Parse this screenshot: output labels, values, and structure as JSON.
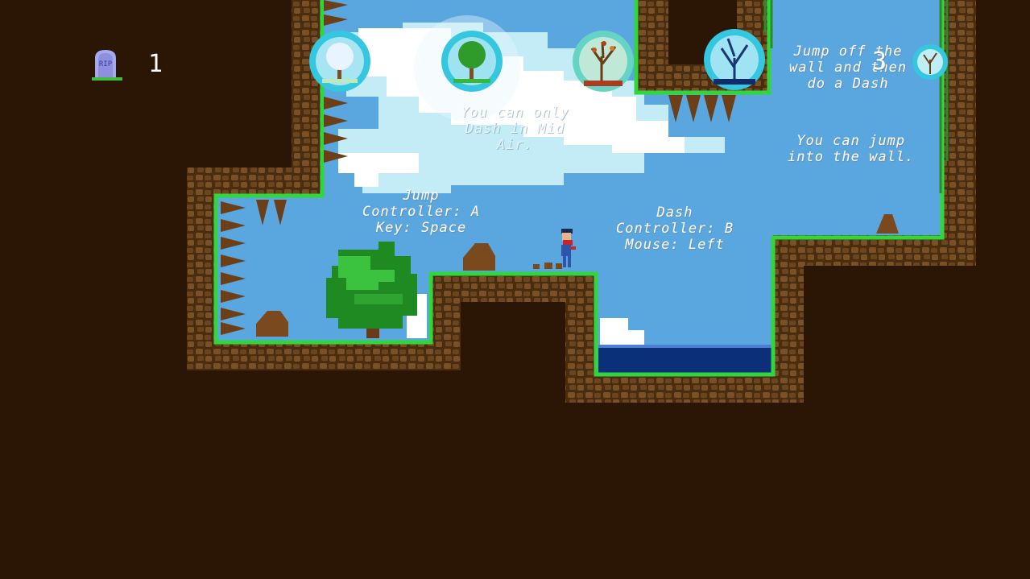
{
  "hud": {
    "tombstone_label": "RIP",
    "death_count": "1",
    "icon": "tombstone-icon"
  },
  "orbs": [
    {
      "name": "winter-tree-orb",
      "icon": "snowy-tree-icon"
    },
    {
      "name": "spring-tree-orb",
      "icon": "green-tree-icon"
    },
    {
      "name": "autumn-tree-orb",
      "icon": "autumn-tree-icon"
    },
    {
      "name": "dead-tree-orb",
      "icon": "bare-tree-icon"
    },
    {
      "name": "small-orb",
      "icon": "mini-tree-icon"
    }
  ],
  "stage_number": "3",
  "tutorial": {
    "dash_midair": [
      "You can only",
      "Dash in Mid",
      "Air."
    ],
    "jump": [
      "Jump",
      "Controller: A",
      "Key: Space"
    ],
    "dash": [
      "Dash",
      "Controller: B",
      "Mouse: Left"
    ],
    "walljump_dash": [
      "Jump off the",
      "wall and then",
      "do a Dash"
    ],
    "wall_jump": [
      "You can jump",
      "into the wall."
    ]
  },
  "colors": {
    "sky": "#5aa7e0",
    "dirt_dark": "#2b1605",
    "dirt_tile": "#7a5126",
    "grass": "#31d63c",
    "water": "#0c2f7a",
    "cloud": "#ffffff",
    "cloud_light": "#c4ecf7",
    "player_body": "#2d55a8",
    "player_scarf": "#c9242a"
  }
}
